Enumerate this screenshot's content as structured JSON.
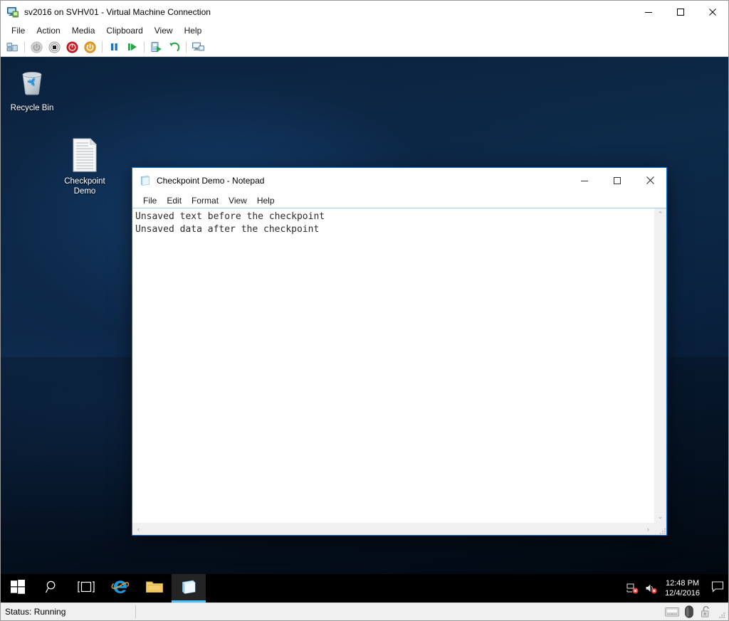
{
  "window": {
    "title": "sv2016 on SVHV01 - Virtual Machine Connection",
    "icon": "virtual-machine-icon",
    "controls": {
      "minimize": "—",
      "maximize": "☐",
      "close": "✕"
    }
  },
  "menubar": {
    "items": [
      {
        "label": "File"
      },
      {
        "label": "Action"
      },
      {
        "label": "Media"
      },
      {
        "label": "Clipboard"
      },
      {
        "label": "View"
      },
      {
        "label": "Help"
      }
    ]
  },
  "toolbar": {
    "buttons": [
      {
        "name": "ctrl-alt-delete-icon",
        "tooltip": "Ctrl+Alt+Delete"
      },
      {
        "name": "start-icon",
        "tooltip": "Start"
      },
      {
        "name": "turn-off-icon",
        "tooltip": "Turn Off"
      },
      {
        "name": "shut-down-icon",
        "tooltip": "Shut Down"
      },
      {
        "name": "reset-icon",
        "tooltip": "Reset"
      },
      {
        "name": "pause-icon",
        "tooltip": "Pause"
      },
      {
        "name": "resume-icon",
        "tooltip": "Resume"
      },
      {
        "name": "checkpoint-icon",
        "tooltip": "Checkpoint"
      },
      {
        "name": "revert-icon",
        "tooltip": "Revert"
      },
      {
        "name": "enhanced-session-icon",
        "tooltip": "Enhanced Session"
      }
    ]
  },
  "desktop": {
    "icons": [
      {
        "name": "recycle-bin",
        "label": "Recycle Bin",
        "glyph": "recycle-bin-icon"
      },
      {
        "name": "checkpoint-demo-file",
        "label": "Checkpoint\nDemo",
        "label_line1": "Checkpoint",
        "label_line2": "Demo",
        "glyph": "text-document-icon"
      }
    ]
  },
  "notepad": {
    "title": "Checkpoint Demo - Notepad",
    "icon": "notepad-icon",
    "controls": {
      "minimize": "—",
      "maximize": "☐",
      "close": "✕"
    },
    "menu": [
      {
        "label": "File"
      },
      {
        "label": "Edit"
      },
      {
        "label": "Format"
      },
      {
        "label": "View"
      },
      {
        "label": "Help"
      }
    ],
    "content": "Unsaved text before the checkpoint\nUnsaved data after the checkpoint",
    "scroll": {
      "up_arrow": "⌃",
      "down_arrow": "⌄",
      "left_arrow": "‹",
      "right_arrow": "›"
    }
  },
  "taskbar": {
    "items": [
      {
        "name": "start-button",
        "icon": "windows-logo-icon",
        "label": "Start",
        "active": false
      },
      {
        "name": "search-button",
        "icon": "search-icon",
        "label": "Search",
        "active": false
      },
      {
        "name": "task-view-button",
        "icon": "task-view-icon",
        "label": "Task View",
        "active": false
      },
      {
        "name": "internet-explorer-button",
        "icon": "internet-explorer-icon",
        "label": "Internet Explorer",
        "active": false
      },
      {
        "name": "file-explorer-button",
        "icon": "file-explorer-icon",
        "label": "File Explorer",
        "active": false
      },
      {
        "name": "notepad-taskbar-button",
        "icon": "notepad-icon",
        "label": "Checkpoint Demo - Notepad",
        "active": true
      }
    ],
    "tray": {
      "network": {
        "name": "network-disconnected-icon",
        "label": "No Internet access"
      },
      "volume": {
        "name": "volume-muted-icon",
        "label": "Speakers muted"
      },
      "time": "12:48 PM",
      "date": "12/4/2016",
      "action_center": {
        "name": "action-center-icon",
        "label": "Action Center"
      }
    }
  },
  "statusbar": {
    "status": "Status: Running",
    "icons": [
      {
        "name": "keyboard-icon",
        "label": "Keyboard capture"
      },
      {
        "name": "mouse-icon",
        "label": "Mouse capture"
      },
      {
        "name": "padlock-unlocked-icon",
        "label": "Unlocked"
      }
    ]
  },
  "colors": {
    "accent": "#0078d7",
    "taskbar": "#000000",
    "window_chrome": "#ffffff",
    "statusbar": "#f0f0f0",
    "desktop_top": "#0d2a4a",
    "desktop_bottom": "#020a16"
  }
}
